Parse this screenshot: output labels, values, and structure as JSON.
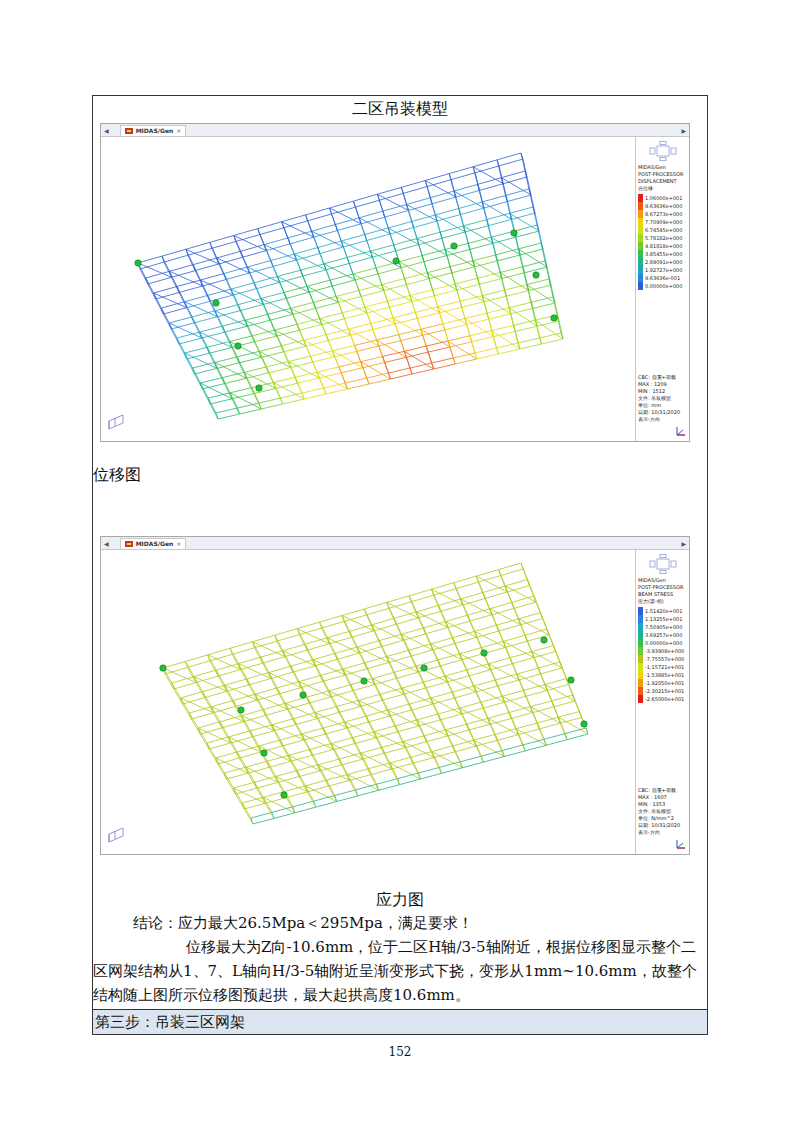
{
  "page": {
    "title": "二区吊装模型",
    "number": "152"
  },
  "figures": [
    {
      "caption": "位移图",
      "tab": "MIDAS/Gen",
      "close": "×",
      "scroll_left": "◀",
      "scroll_right": "▶",
      "legend": {
        "header": [
          "MIDAS/Gen",
          "POST-PROCESSOR",
          "DISPLACEMENT",
          "合位移"
        ],
        "entries": [
          {
            "value": "1.06000e+001",
            "color": "#e0201b"
          },
          {
            "value": "9.63636e+000",
            "color": "#f05a14"
          },
          {
            "value": "8.67273e+000",
            "color": "#f59a10"
          },
          {
            "value": "7.70909e+000",
            "color": "#f2d10f"
          },
          {
            "value": "6.74545e+000",
            "color": "#d6e012"
          },
          {
            "value": "5.78182e+000",
            "color": "#a8d81a"
          },
          {
            "value": "4.81818e+000",
            "color": "#6ccc2a"
          },
          {
            "value": "3.85455e+000",
            "color": "#35c04a"
          },
          {
            "value": "2.89091e+000",
            "color": "#22b28a"
          },
          {
            "value": "1.92727e+000",
            "color": "#1fa6c4"
          },
          {
            "value": "9.63636e-001",
            "color": "#2a86dc"
          },
          {
            "value": "0.00000e+000",
            "color": "#2f5fd8"
          }
        ],
        "footer": [
          "CBC: 自重+荷载",
          "MAX : 1209",
          "MIN : 1512",
          "文件: 吊装模型",
          "单位: mm",
          "日期: 10/31/2020",
          "表示-方向"
        ]
      }
    },
    {
      "caption": "应力图",
      "tab": "MIDAS/Gen",
      "close": "×",
      "scroll_left": "◀",
      "scroll_right": "▶",
      "legend": {
        "header": [
          "MIDAS/Gen",
          "POST-PROCESSOR",
          "BEAM STRESS",
          "应力(梁-组)"
        ],
        "entries": [
          {
            "value": "1.51420e+001",
            "color": "#2f5fd8"
          },
          {
            "value": "1.13255e+001",
            "color": "#2a86dc"
          },
          {
            "value": "7.50905e+000",
            "color": "#1fa6c4"
          },
          {
            "value": "3.69257e+000",
            "color": "#22b28a"
          },
          {
            "value": "0.00000e+000",
            "color": "#35c04a"
          },
          {
            "value": "-3.93908e+000",
            "color": "#6ccc2a"
          },
          {
            "value": "-7.75557e+000",
            "color": "#b3c81a"
          },
          {
            "value": "-1.15721e+001",
            "color": "#d6e012"
          },
          {
            "value": "-1.53885e+001",
            "color": "#f2d10f"
          },
          {
            "value": "-1.92050e+001",
            "color": "#f59a10"
          },
          {
            "value": "-2.30215e+001",
            "color": "#f05a14"
          },
          {
            "value": "-2.65000e+001",
            "color": "#e0201b"
          }
        ],
        "footer": [
          "CBC: 自重+荷载",
          "MAX : 1607",
          "MIN : 1353",
          "文件: 吊装模型",
          "单位: N/mm^2",
          "日期: 10/31/2020",
          "表示-方向"
        ]
      }
    }
  ],
  "conclusion": [
    "结论：应力最大26.5Mpa＜295Mpa，满足要求！",
    "位移最大为Z向-10.6mm，位于二区H轴/3-5轴附近，根据位移图显示整个二区网架结构从1、7、L轴向H/3-5轴附近呈渐变形式下挠，变形从1mm~10.6mm，故整个结构随上图所示位移图预起拱，最大起拱高度10.6mm。"
  ],
  "next_step": "第三步：吊装三区网架"
}
